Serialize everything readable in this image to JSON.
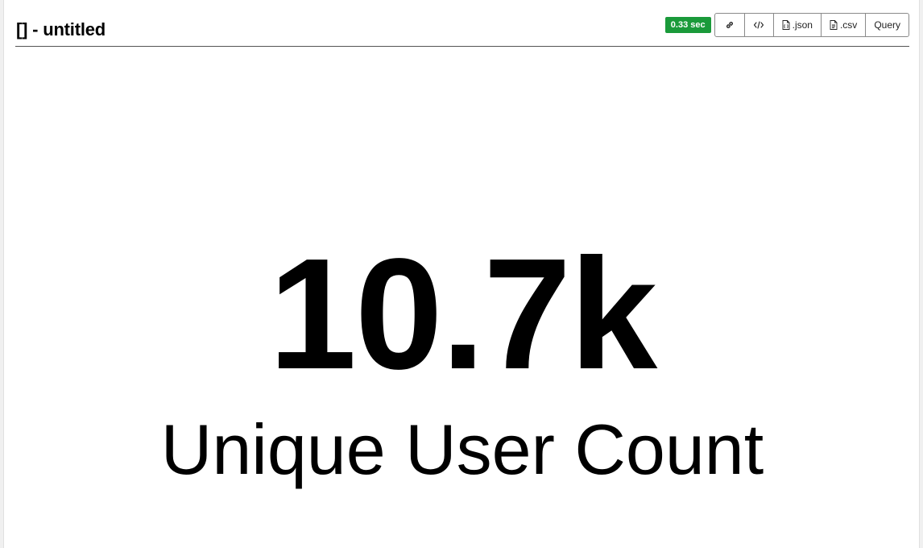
{
  "header": {
    "title": "[] - untitled"
  },
  "toolbar": {
    "timing": "0.33 sec",
    "buttons": {
      "link_icon": "link-icon",
      "embed_icon": "code-icon",
      "json_label": ".json",
      "json_icon": "file-json-icon",
      "csv_label": ".csv",
      "csv_icon": "file-csv-icon",
      "query_label": "Query"
    }
  },
  "big_number": {
    "value": "10.7k",
    "subheader": "Unique User Count"
  },
  "colors": {
    "timing_badge_bg": "#1a9a3a",
    "text": "#000000",
    "background": "#ffffff"
  }
}
